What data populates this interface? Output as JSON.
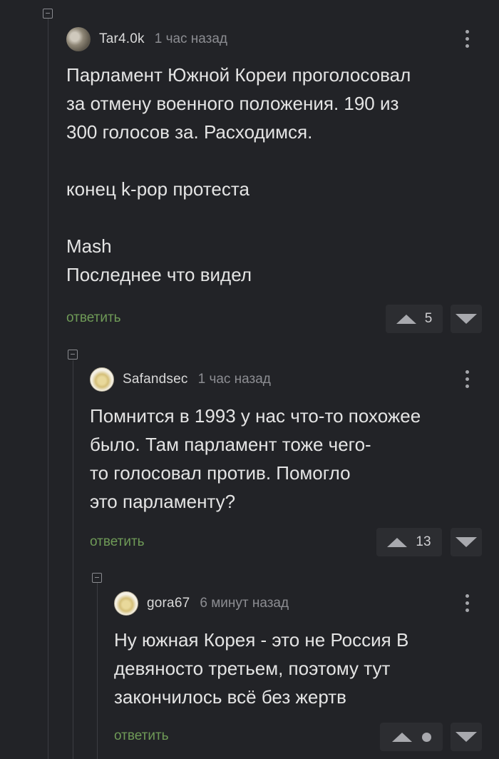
{
  "comments": [
    {
      "username": "Tar4.0k",
      "time": "1 час назад",
      "text": "Парламент Южной Кореи проголосовал\nза отмену военного положения. 190 из\n300 голосов за. Расходимся.\n\nконец k-pop протеста\n\nMash\nПоследнее что видел",
      "reply_label": "ответить",
      "votes": "5",
      "avatar_icon": "user-photo-avatar"
    },
    {
      "username": "Safandsec",
      "time": "1 час назад",
      "text": "Помнится в 1993 у нас что-то похожее\nбыло. Там парламент тоже чего-\nто голосовал против. Помогло\nэто парламенту?",
      "reply_label": "ответить",
      "votes": "13",
      "avatar_icon": "default-avatar"
    },
    {
      "username": "gora67",
      "time": "6 минут назад",
      "text": "Ну южная Корея - это не Россия В\nдевяносто третьем, поэтому тут\nзакончилось всё без жертв",
      "reply_label": "ответить",
      "votes": "",
      "avatar_icon": "default-avatar"
    }
  ],
  "colors": {
    "background": "#222327",
    "reply_link": "#6f9a57",
    "vote_box": "#2c2d31"
  }
}
